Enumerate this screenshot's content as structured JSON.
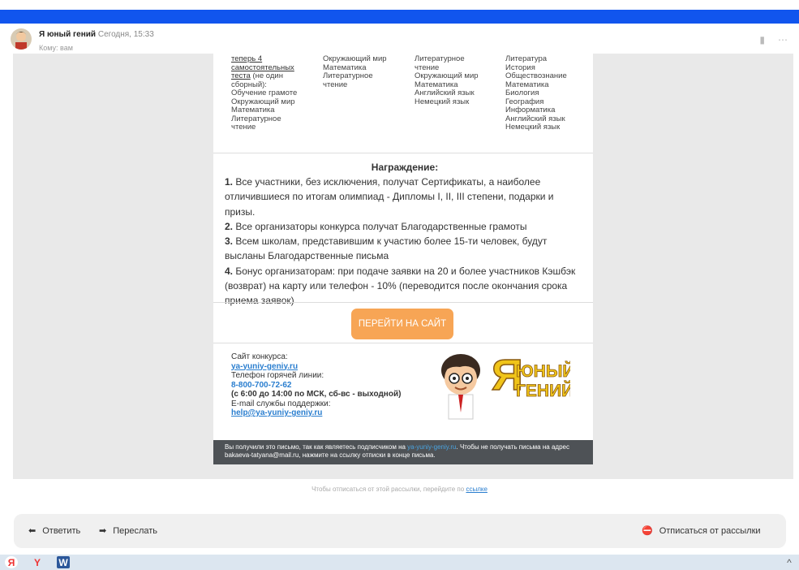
{
  "header": {
    "sender_name": "Я юный гений",
    "date": "Сегодня, 15:33",
    "to": "Кому: вам"
  },
  "subjects": {
    "col1": [
      "теперь 4",
      "самостоятельных",
      "теста",
      "(не один",
      "сборный):",
      "Обучение грамоте",
      "Окружающий мир",
      "Математика",
      "Литературное",
      "чтение"
    ],
    "col2": [
      "Окружающий мир",
      "Математика",
      "Литературное",
      "чтение"
    ],
    "col3": [
      "Литературное",
      "чтение",
      "Окружающий мир",
      "Математика",
      "Английский язык",
      "Немецкий язык"
    ],
    "col4": [
      "Литература",
      "История",
      "Обществознание",
      "Математика",
      "Биология",
      "География",
      "Информатика",
      "Английский язык",
      "Немецкий язык"
    ]
  },
  "awards": {
    "title": "Награждение:",
    "items": [
      {
        "num": "1.",
        "text": "Все участники, без исключения, получат Сертификаты, а наиболее отличившиеся по итогам олимпиад - Дипломы I, II, III степени, подарки и призы."
      },
      {
        "num": "2.",
        "text": "Все организаторы конкурса получат Благодарственные грамоты"
      },
      {
        "num": "3.",
        "text": "Всем школам, представившим к участию более 15-ти человек, будут высланы Благодарственные письма"
      },
      {
        "num": "4.",
        "text": "Бонус организаторам: при подаче заявки на 20 и более участников Кэшбэк (возврат) на карту или телефон - 10% (переводится после окончания срока приема заявок)"
      }
    ]
  },
  "button_label": "ПЕРЕЙТИ НА САЙТ",
  "contacts": {
    "site_label": "Сайт конкурса:",
    "site": "ya-yuniy-geniy.ru",
    "hotline_label": "Телефон горячей линии:",
    "phone": "8-800-700-72-62",
    "hours": "(с 6:00 до 14:00 по МСК, сб-вс - выходной)",
    "email_label": "E-mail службы поддержки:",
    "email": "help@ya-yuniy-geniy.ru"
  },
  "logo_text": {
    "line1": "ЮНЫЙ",
    "line2": "ГЕНИЙ",
    "letter": "Я"
  },
  "unsub_bar": {
    "part1": "Вы получили это письмо, так как являетесь подписчиком на",
    "link": "ya-yuniy-geniy.ru",
    "part2": ". Чтобы не получать письма на адрес bakaeva-tatyana@mail.ru, нажмите на ссылку отписки в конце письма."
  },
  "bottom_note": {
    "text": "Чтобы отписаться от этой рассылки, перейдите по",
    "link": "ссылке"
  },
  "actions": {
    "reply": "Ответить",
    "forward": "Переслать",
    "unsubscribe": "Отписаться от рассылки"
  },
  "colors": {
    "accent": "#1155ee",
    "button": "#f7a555",
    "link": "#2a7ecf"
  }
}
